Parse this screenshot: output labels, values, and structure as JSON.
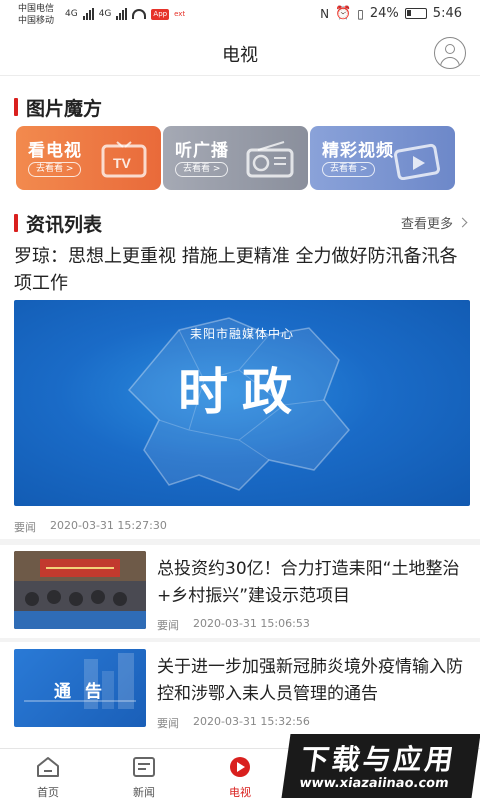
{
  "status_bar": {
    "carrier_1": "中国电信",
    "carrier_2": "中国移动",
    "network_1": "4G",
    "network_2": "4G",
    "app_badge": "App",
    "small_tag": "ext",
    "battery": "24%",
    "time": "5:46"
  },
  "header": {
    "title": "电视",
    "profile_icon": "user-circle-icon"
  },
  "picture_cube": {
    "title": "图片魔方",
    "cards": [
      {
        "label": "看电视",
        "sub": "去看看 >",
        "icon": "tv-icon",
        "color": "#ee7a45"
      },
      {
        "label": "听广播",
        "sub": "去看看 >",
        "icon": "radio-icon",
        "color": "#9aa0ab"
      },
      {
        "label": "精彩视频",
        "sub": "去看看 >",
        "icon": "video-icon",
        "color": "#7c95d2"
      }
    ]
  },
  "news": {
    "title": "资讯列表",
    "more": "查看更多",
    "lead": {
      "title": "罗琼：思想上更重视 措施上更精准 全力做好防汛备汛各项工作",
      "banner_org": "耒阳市融媒体中心",
      "banner_text": "时政",
      "tag": "要闻",
      "time": "2020-03-31 15:27:30"
    },
    "items": [
      {
        "title": "总投资约30亿！合力打造耒阳“土地整治+乡村振兴”建设示范项目",
        "tag": "要闻",
        "time": "2020-03-31 15:06:53"
      },
      {
        "title": "关于进一步加强新冠肺炎境外疫情输入防控和涉鄂入耒人员管理的通告",
        "thumb_text": "通  告",
        "tag": "要闻",
        "time": "2020-03-31 15:32:56"
      }
    ]
  },
  "tabbar": {
    "tabs": [
      {
        "label": "首页",
        "icon": "home-icon"
      },
      {
        "label": "新闻",
        "icon": "newspaper-icon"
      },
      {
        "label": "电视",
        "icon": "play-circle-icon",
        "active": true
      }
    ]
  },
  "watermark": {
    "main": "下载与应用",
    "url": "www.xiazaiinao.com"
  },
  "colors": {
    "accent": "#d9201e",
    "banner_blue": "#1a6bc7"
  }
}
